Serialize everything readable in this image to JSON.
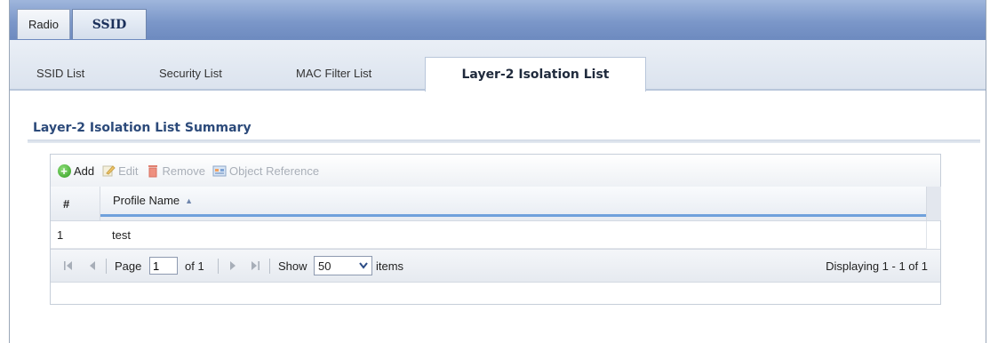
{
  "top_tabs": [
    {
      "label": "Radio"
    },
    {
      "label": "SSID"
    }
  ],
  "sub_tabs": [
    {
      "label": "SSID List"
    },
    {
      "label": "Security List"
    },
    {
      "label": "MAC Filter List"
    },
    {
      "label": "Layer-2 Isolation List"
    }
  ],
  "summary": {
    "title": "Layer-2 Isolation List Summary"
  },
  "toolbar": {
    "add_label": "Add",
    "edit_label": "Edit",
    "remove_label": "Remove",
    "object_reference_label": "Object Reference"
  },
  "table": {
    "columns": [
      "#",
      "Profile Name"
    ],
    "sort_indicator": "▲",
    "rows": [
      {
        "index": "1",
        "profile_name": "test"
      }
    ]
  },
  "pager": {
    "page_label": "Page",
    "page_value": "1",
    "of_label": "of 1",
    "show_label": "Show",
    "show_value": "50",
    "items_label": "items",
    "display_info": "Displaying 1 - 1 of 1"
  },
  "icons": {
    "add": "add-icon",
    "edit": "edit-icon",
    "remove": "trash-icon",
    "object_reference": "object-reference-icon"
  },
  "colors": {
    "title": "#2c4a7a",
    "header_bar": "#7b97c9",
    "sort_underline": "#6fa1dc"
  }
}
